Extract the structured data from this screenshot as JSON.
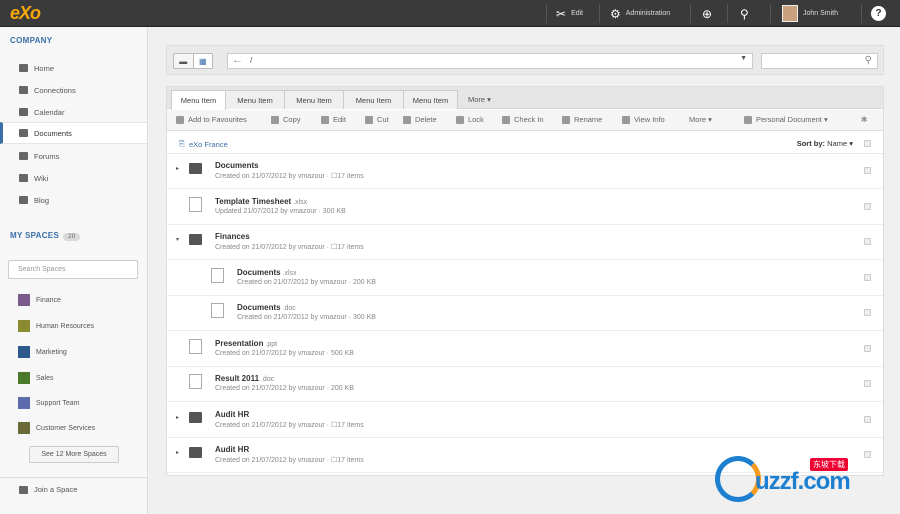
{
  "topbar": {
    "logo": "eXo",
    "edit": "Edit",
    "administration": "Administration",
    "user_name": "John Smith"
  },
  "sidebar": {
    "company_title": "COMPANY",
    "nav": [
      {
        "label": "Home"
      },
      {
        "label": "Connections"
      },
      {
        "label": "Calendar"
      },
      {
        "label": "Documents"
      },
      {
        "label": "Forums"
      },
      {
        "label": "Wiki"
      },
      {
        "label": "Blog"
      }
    ],
    "spaces_title": "MY SPACES",
    "spaces_count": "20",
    "search_placeholder": "Search Spaces",
    "spaces": [
      {
        "label": "Finance",
        "color": "#7a5a8a"
      },
      {
        "label": "Human Resources",
        "color": "#8a8a30"
      },
      {
        "label": "Marketing",
        "color": "#2a5a8a"
      },
      {
        "label": "Sales",
        "color": "#4a7a2a"
      },
      {
        "label": "Support Team",
        "color": "#5a6aaa"
      },
      {
        "label": "Customer Services",
        "color": "#6a6a3a"
      }
    ],
    "more_spaces": "See 12 More Spaces",
    "join": "Join a Space"
  },
  "toolbar": {
    "path": "/",
    "search_value": ""
  },
  "tabs": [
    {
      "label": "Menu Item"
    },
    {
      "label": "Menu Item"
    },
    {
      "label": "Menu Item"
    },
    {
      "label": "Menu Item"
    },
    {
      "label": "Menu Item"
    }
  ],
  "tabs_more": "More ▾",
  "actions": [
    {
      "label": "Add to Favourites"
    },
    {
      "label": "Copy"
    },
    {
      "label": "Edit"
    },
    {
      "label": "Cut"
    },
    {
      "label": "Delete"
    },
    {
      "label": "Lock"
    },
    {
      "label": "Check In"
    },
    {
      "label": "Rename"
    },
    {
      "label": "View Info"
    },
    {
      "label": "More ▾"
    },
    {
      "label": "Personal Document ▾"
    }
  ],
  "breadcrumb": "eXo France",
  "sort": {
    "label": "Sort by:",
    "value": "Name ▾"
  },
  "rows": [
    {
      "name": "Documents",
      "ext": "",
      "meta": "Created on 21/07/2012 by vmazour · ☐17 items",
      "type": "folder",
      "arrow": "▸"
    },
    {
      "name": "Template Timesheet",
      "ext": " .xlsx",
      "meta": "Updated 21/07/2012 by vmazour · 300 KB",
      "type": "file",
      "arrow": ""
    },
    {
      "name": "Finances",
      "ext": "",
      "meta": "Created on 21/07/2012 by vmazour · ☐17 items",
      "type": "folder",
      "arrow": "▾"
    },
    {
      "name": "Documents",
      "ext": " .xlsx",
      "meta": "Created on 21/07/2012 by vmazour · 200 KB",
      "type": "file",
      "arrow": ""
    },
    {
      "name": "Documents",
      "ext": " .doc",
      "meta": "Created on 21/07/2012 by vmazour · 300 KB",
      "type": "file",
      "arrow": ""
    },
    {
      "name": "Presentation",
      "ext": " .ppt",
      "meta": "Created on 21/07/2012 by vmazour · 500 KB",
      "type": "file",
      "arrow": ""
    },
    {
      "name": "Result 2011",
      "ext": " .doc",
      "meta": "Created on 21/07/2012 by vmazour · 200 KB",
      "type": "file",
      "arrow": ""
    },
    {
      "name": "Audit HR",
      "ext": "",
      "meta": "Created on 21/07/2012 by vmazour · ☐17 items",
      "type": "folder",
      "arrow": "▸"
    },
    {
      "name": "Audit HR",
      "ext": "",
      "meta": "Created on 21/07/2012 by vmazour · ☐17 items",
      "type": "folder",
      "arrow": "▸"
    }
  ],
  "watermark": {
    "text": "uzzf.com",
    "cn": "东坡下载"
  }
}
